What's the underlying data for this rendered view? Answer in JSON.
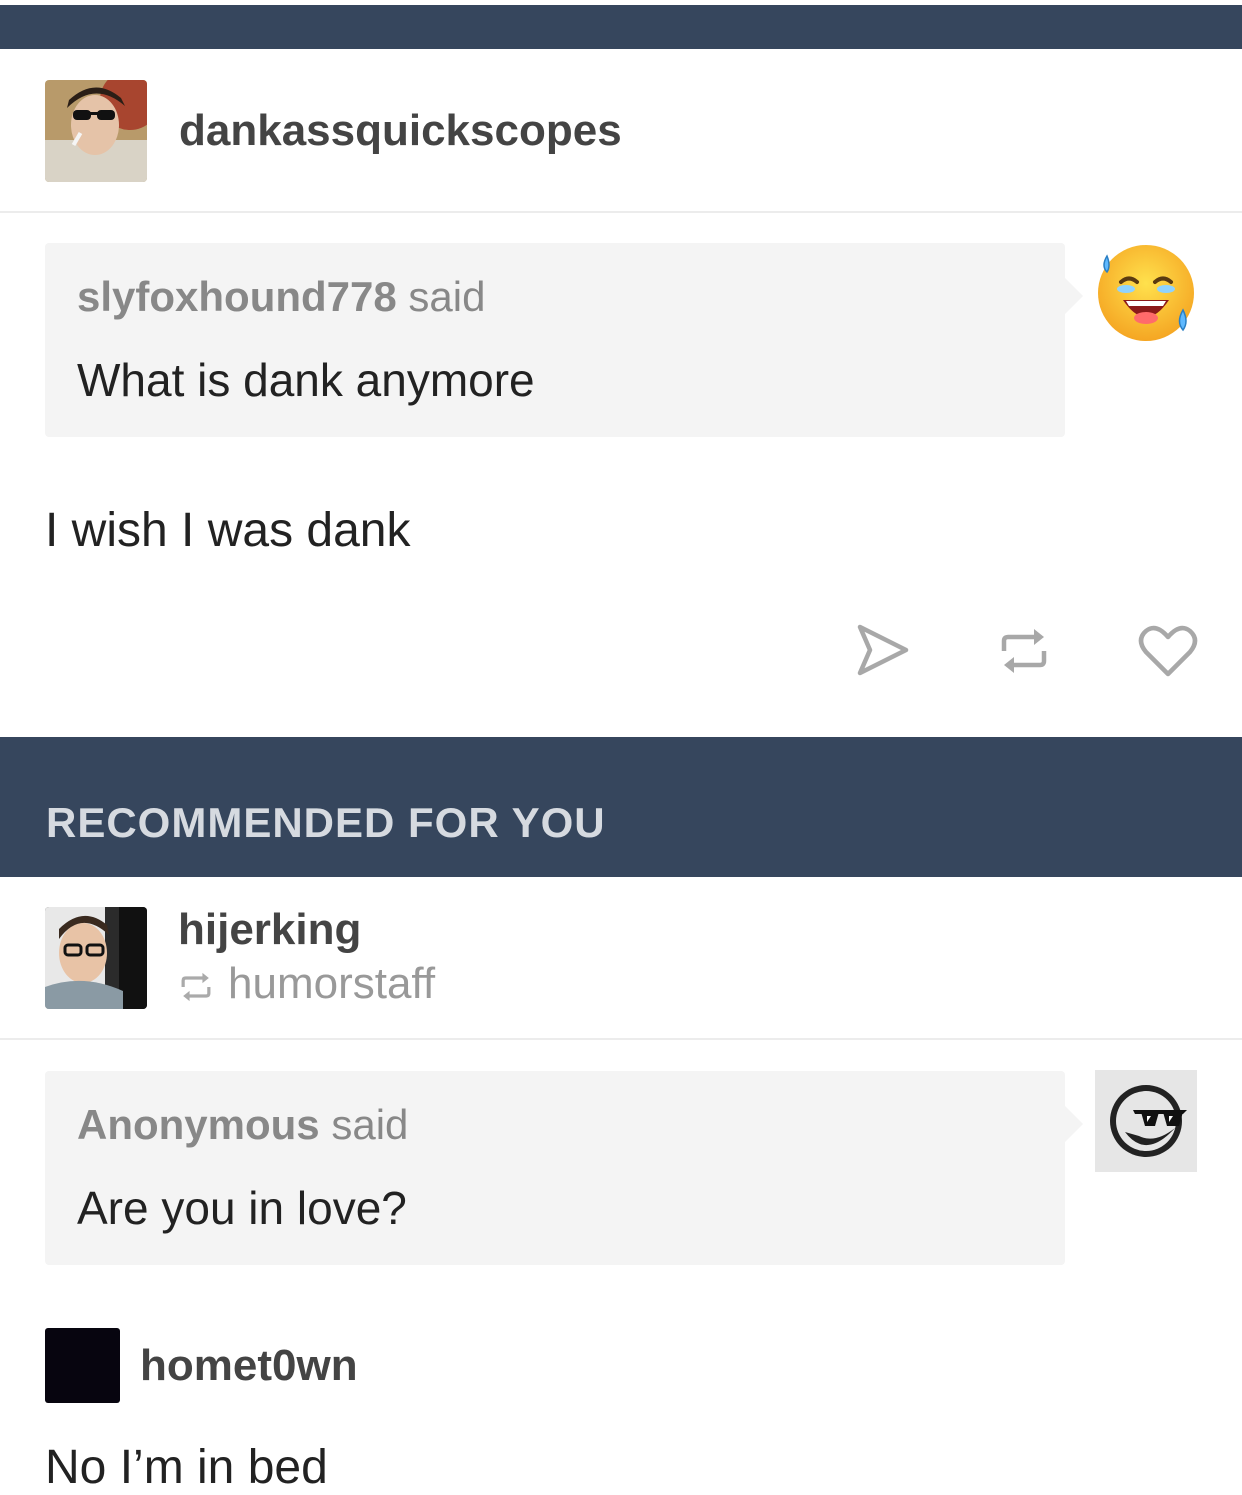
{
  "colors": {
    "header_bar": "#36465d",
    "ask_box": "#f4f4f4",
    "muted_text": "#888888",
    "body_text": "#222222"
  },
  "post1": {
    "blog_name": "dankassquickscopes",
    "ask": {
      "asker": "slyfoxhound778",
      "said_label": "said",
      "question": "What is dank anymore",
      "asker_avatar_icon": "sweat-laughing-emoji-icon"
    },
    "answer": "I wish I was dank",
    "actions": [
      {
        "icon": "share-arrow-icon"
      },
      {
        "icon": "reblog-icon"
      },
      {
        "icon": "heart-icon"
      }
    ]
  },
  "recommended": {
    "title": "RECOMMENDED FOR YOU"
  },
  "post2": {
    "blog_name": "hijerking",
    "reblogged_from": "humorstaff",
    "ask": {
      "asker": "Anonymous",
      "said_label": "said",
      "question": "Are you in love?",
      "asker_avatar_icon": "anonymous-sunglasses-icon"
    },
    "answerer": "homet0wn",
    "answer": "No I’m in bed"
  }
}
